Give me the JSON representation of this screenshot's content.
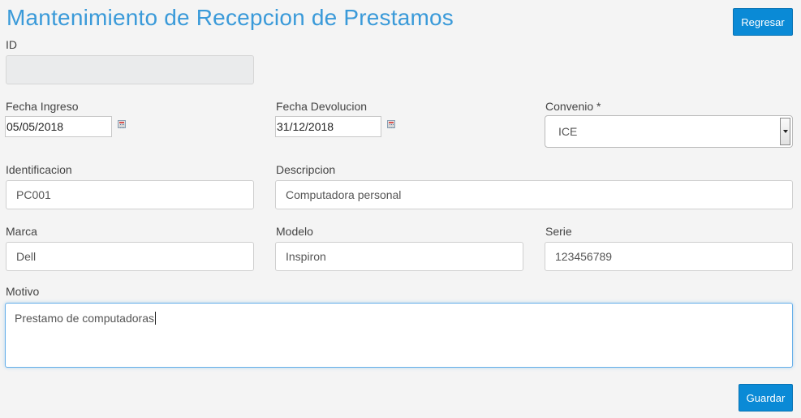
{
  "page": {
    "title": "Mantenimiento de Recepcion de Prestamos"
  },
  "buttons": {
    "back": "Regresar",
    "save": "Guardar"
  },
  "form": {
    "id": {
      "label": "ID",
      "value": ""
    },
    "fecha_ingreso": {
      "label": "Fecha Ingreso",
      "value": "05/05/2018"
    },
    "fecha_devolucion": {
      "label": "Fecha Devolucion",
      "value": "31/12/2018"
    },
    "convenio": {
      "label": "Convenio *",
      "value": "ICE"
    },
    "identificacion": {
      "label": "Identificacion",
      "value": "PC001"
    },
    "descripcion": {
      "label": "Descripcion",
      "value": "Computadora personal"
    },
    "marca": {
      "label": "Marca",
      "value": "Dell"
    },
    "modelo": {
      "label": "Modelo",
      "value": "Inspiron"
    },
    "serie": {
      "label": "Serie",
      "value": "123456789"
    },
    "motivo": {
      "label": "Motivo",
      "value": "Prestamo de computadoras"
    }
  },
  "icons": {
    "calendar": "calendar-icon",
    "dropdown": "chevron-down-icon"
  },
  "colors": {
    "accent": "#0a8ad6",
    "title": "#3a9ad9"
  }
}
